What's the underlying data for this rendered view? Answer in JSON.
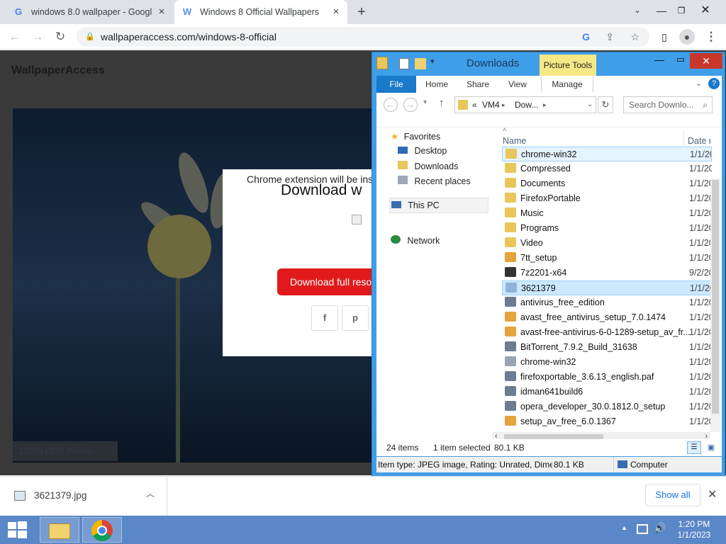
{
  "browser": {
    "tabs": [
      {
        "title": "windows 8.0 wallpaper - Google",
        "favicon": "google-icon",
        "active": false
      },
      {
        "title": "Windows 8 Official Wallpapers -",
        "favicon": "wallpaperaccess-icon",
        "active": true
      }
    ],
    "new_tab": "+",
    "url": "wallpaperaccess.com/windows-8-official"
  },
  "page": {
    "site_name": "WallpaperAccess",
    "modal": {
      "extension_note": "Chrome extension will be ins",
      "title": "Download w",
      "download_button": "Download full reso",
      "share_buttons": [
        "f",
        "p"
      ]
    },
    "size_label": "1920x1200 Windo"
  },
  "downloads_bar": {
    "file": "3621379.jpg",
    "show_all": "Show all"
  },
  "explorer": {
    "title": "Downloads",
    "contextual_tab": "Picture Tools",
    "ribbon_tabs": [
      "File",
      "Home",
      "Share",
      "View",
      "Manage"
    ],
    "address": {
      "root": "«",
      "parts": [
        "VM4",
        "Dow..."
      ]
    },
    "search_placeholder": "Search Downlo...",
    "nav": {
      "favorites": "Favorites",
      "favorites_items": [
        "Desktop",
        "Downloads",
        "Recent places"
      ],
      "this_pc": "This PC",
      "network": "Network"
    },
    "columns": {
      "name": "Name",
      "date": "Date r"
    },
    "files": [
      {
        "name": "chrome-win32",
        "date": "1/1/20",
        "kind": "folder"
      },
      {
        "name": "Compressed",
        "date": "1/1/20",
        "kind": "folder"
      },
      {
        "name": "Documents",
        "date": "1/1/20",
        "kind": "folder"
      },
      {
        "name": "FirefoxPortable",
        "date": "1/1/20",
        "kind": "folder"
      },
      {
        "name": "Music",
        "date": "1/1/20",
        "kind": "folder"
      },
      {
        "name": "Programs",
        "date": "1/1/20",
        "kind": "folder"
      },
      {
        "name": "Video",
        "date": "1/1/20",
        "kind": "folder"
      },
      {
        "name": "7tt_setup",
        "date": "1/1/20",
        "kind": "setup"
      },
      {
        "name": "7z2201-x64",
        "date": "9/2/20",
        "kind": "7z"
      },
      {
        "name": "3621379",
        "date": "1/1/20",
        "kind": "image"
      },
      {
        "name": "antivirus_free_edition",
        "date": "1/1/20",
        "kind": "app"
      },
      {
        "name": "avast_free_antivirus_setup_7.0.1474",
        "date": "1/1/20",
        "kind": "setup"
      },
      {
        "name": "avast-free-antivirus-6-0-1289-setup_av_fr...",
        "date": "1/1/20",
        "kind": "setup"
      },
      {
        "name": "BitTorrent_7.9.2_Build_31638",
        "date": "1/1/20",
        "kind": "app"
      },
      {
        "name": "chrome-win32",
        "date": "1/1/20",
        "kind": "zip"
      },
      {
        "name": "firefoxportable_3.6.13_english.paf",
        "date": "1/1/20",
        "kind": "app"
      },
      {
        "name": "idman641build6",
        "date": "1/1/20",
        "kind": "app"
      },
      {
        "name": "opera_developer_30.0.1812.0_setup",
        "date": "1/1/20",
        "kind": "app"
      },
      {
        "name": "setup_av_free_6.0.1367",
        "date": "1/1/20",
        "kind": "setup"
      }
    ],
    "status": {
      "count": "24 items",
      "selected": "1 item selected",
      "size": "80.1 KB"
    },
    "details": {
      "text": "Item type: JPEG image, Rating: Unrated, Dimer",
      "size": "80.1 KB",
      "location": "Computer"
    }
  },
  "taskbar": {
    "time": "1:20 PM",
    "date": "1/1/2023"
  },
  "colors": {
    "accent_red": "#e01a1a",
    "explorer_blue": "#3f9ee8",
    "file_tab": "#1979ca",
    "taskbar": "#5a87c7"
  }
}
